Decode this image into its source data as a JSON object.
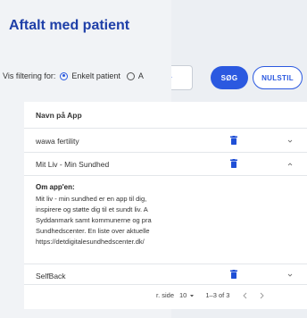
{
  "page": {
    "title": "Aftalt med patient"
  },
  "filter": {
    "label": "Vis filtering for:",
    "option_selected": "Enkelt patient",
    "option_other": "A"
  },
  "actions": {
    "search_label": "SØG",
    "reset_label": "NULSTIL"
  },
  "table": {
    "column_header": "Navn på App",
    "rows": [
      {
        "name": "wawa fertility"
      },
      {
        "name": "Mit Liv - Min Sundhed"
      },
      {
        "name": "SelfBack"
      }
    ],
    "expanded": {
      "title": "Om app'en:",
      "lines": [
        "Mit liv - min sundhed er en app til dig, ",
        "inspirere og støtte dig til et sundt liv. A",
        "Syddanmark samt kommunerne og pra",
        "Sundhedscenter. En liste over aktuelle",
        "https://detdigitalesundhedscenter.dk/"
      ]
    }
  },
  "pagination": {
    "rows_label": "r. side",
    "rows_value": "10",
    "range": "1–3 of 3"
  },
  "colors": {
    "accent": "#2b59e0",
    "title": "#1e3fa8",
    "trash": "#1f4fd6",
    "background_outer": "#8cc06e"
  }
}
